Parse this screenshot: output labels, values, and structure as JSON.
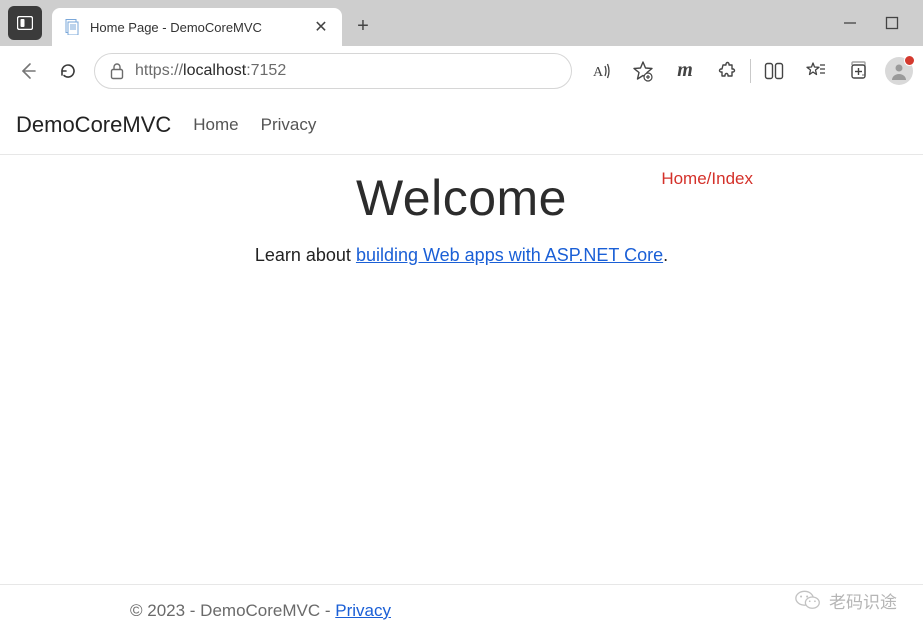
{
  "browser": {
    "tab": {
      "title": "Home Page - DemoCoreMVC"
    },
    "url": {
      "scheme": "https://",
      "host": "localhost",
      "port": ":7152"
    }
  },
  "nav": {
    "brand": "DemoCoreMVC",
    "links": [
      "Home",
      "Privacy"
    ]
  },
  "page": {
    "annotation": "Home/Index",
    "heading": "Welcome",
    "lead_prefix": "Learn about ",
    "lead_link": "building Web apps with ASP.NET Core",
    "lead_suffix": "."
  },
  "footer": {
    "copyright": "© 2023 - DemoCoreMVC - ",
    "privacy": "Privacy"
  },
  "watermark": {
    "text": "老码识途"
  }
}
